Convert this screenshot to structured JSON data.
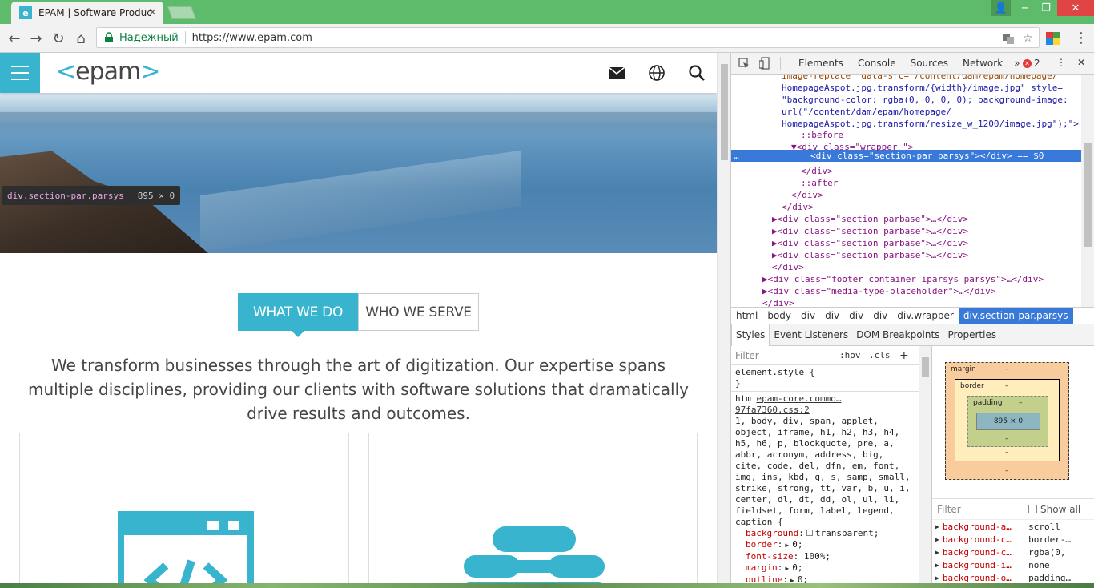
{
  "browser": {
    "tab_title": "EPAM | Software Product",
    "favicon_letter": "e",
    "tab_close": "×",
    "window_controls": {
      "minimize": "−",
      "maximize": "❐",
      "close": "✕"
    },
    "nav": {
      "back": "←",
      "forward": "→",
      "reload": "↻",
      "home": "⌂"
    },
    "secure_label": "Надежный",
    "url": "https://www.epam.com",
    "menu": "⋮"
  },
  "page": {
    "logo_left": "<",
    "logo_text": "epam",
    "logo_right": ">",
    "tooltip": {
      "name": "div.section-par.parsys",
      "size": "895 × 0"
    },
    "tabs": {
      "active": "WHAT WE DO",
      "inactive": "WHO WE SERVE"
    },
    "lead_text": "We transform businesses through the art of digitization. Our expertise spans multiple disciplines, providing our clients with software solutions that dramatically drive results and outcomes.",
    "accent_color": "#39b4cf"
  },
  "devtools": {
    "tabs": [
      "Elements",
      "Console",
      "Sources",
      "Network"
    ],
    "more": "»",
    "error_count": "2",
    "close": "✕",
    "elements": [
      {
        "text": "image-replace\" data-src=\"/content/dam/epam/homepage/",
        "kind": "plain"
      },
      {
        "text": "HomepageAspot.jpg.transform/{width}/image.jpg\" style=",
        "kind": "plain"
      },
      {
        "text": "\"background-color: rgba(0, 0, 0, 0); background-image:",
        "kind": "val"
      },
      {
        "text": "url(\"/content/dam/epam/homepage/",
        "kind": "val"
      },
      {
        "text": "HomepageAspot.jpg.transform/resize_w_1200/image.jpg\");\">",
        "kind": "val"
      },
      {
        "text": "::before",
        "kind": "pseudo"
      },
      {
        "text": "▼<div class=\"wrapper \">",
        "kind": "tag"
      },
      {
        "text": "<div class=\"section-par parsys\"></div> == $0",
        "kind": "selected"
      },
      {
        "text": "</div>",
        "kind": "tag"
      },
      {
        "text": "::after",
        "kind": "pseudo"
      },
      {
        "text": "</div>",
        "kind": "tag"
      },
      {
        "text": "</div>",
        "kind": "tag"
      },
      {
        "text": "▶<div class=\"section parbase\">…</div>",
        "kind": "tag"
      },
      {
        "text": "▶<div class=\"section parbase\">…</div>",
        "kind": "tag"
      },
      {
        "text": "▶<div class=\"section parbase\">…</div>",
        "kind": "tag"
      },
      {
        "text": "▶<div class=\"section parbase\">…</div>",
        "kind": "tag"
      },
      {
        "text": "</div>",
        "kind": "tag"
      },
      {
        "text": "▶<div class=\"footer_container iparsys parsys\">…</div>",
        "kind": "tag"
      },
      {
        "text": "▶<div class=\"media-type-placeholder\">…</div>",
        "kind": "tag"
      },
      {
        "text": "</div>",
        "kind": "tag"
      }
    ],
    "ellipsis": "…",
    "breadcrumbs": [
      "html",
      "body",
      "div",
      "div",
      "div",
      "div",
      "div.wrapper",
      "div.section-par.parsys"
    ],
    "subtabs": [
      "Styles",
      "Event Listeners",
      "DOM Breakpoints",
      "Properties"
    ],
    "styles": {
      "filter_placeholder": "Filter",
      "hov": ":hov",
      "cls": ".cls",
      "plus": "+",
      "element_style": "element.style {",
      "element_style_close": "}",
      "source_prefix": "htm",
      "source_link": "epam-core.commo…97fa7360.css:2",
      "selector": "1, body, div, span, applet, object, iframe, h1, h2, h3, h4, h5, h6, p, blockquote, pre, a, abbr, acronym, address, big, cite, code, del, dfn, em, font, img, ins, kbd, q, s, samp, small, strike, strong, tt, var, b, u, i, center, dl, dt, dd, ol, ul, li, fieldset, form, label, legend, caption {",
      "props": [
        {
          "name": "background",
          "value": "transparent;"
        },
        {
          "name": "border",
          "value": "0;"
        },
        {
          "name": "font-size",
          "value": "100%;"
        },
        {
          "name": "margin",
          "value": "0;"
        },
        {
          "name": "outline",
          "value": "0;"
        }
      ]
    },
    "box_model": {
      "margin": "margin",
      "border": "border",
      "padding": "padding",
      "content": "895 × 0",
      "dash": "–"
    },
    "computed": {
      "filter_placeholder": "Filter",
      "show_all": "Show all",
      "rows": [
        {
          "prop": "background-a…",
          "value": "scroll"
        },
        {
          "prop": "background-c…",
          "value": "border-…"
        },
        {
          "prop": "background-c…",
          "value": "rgba(0,"
        },
        {
          "prop": "background-i…",
          "value": "none"
        },
        {
          "prop": "background-o…",
          "value": "padding…"
        }
      ]
    }
  }
}
